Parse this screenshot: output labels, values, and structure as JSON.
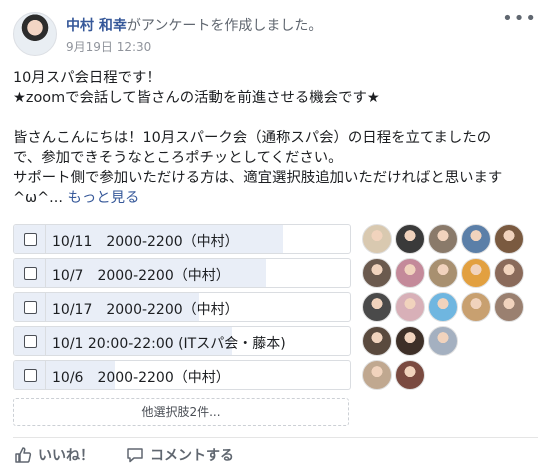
{
  "post": {
    "author": "中村 和幸",
    "action": "がアンケートを作成しました。",
    "timestamp": "9月19日 12:30",
    "more_icon": "•••"
  },
  "body": {
    "line1": "10月スパ会日程です！",
    "line2": "★zoomで会話して皆さんの活動を前進させる機会です★",
    "line3": "皆さんこんにちは！10月スパーク会（通称スパ会）の日程を立てましたの",
    "line4": "で、参加できそうなところポチッとしてください。",
    "line5": "サポート側で参加いただける方は、適宜選択肢追加いただければと思います",
    "line6": "^ω^...",
    "see_more": "もっと見る"
  },
  "poll": {
    "options": [
      {
        "label": "10/11　2000-2200（中村）",
        "fill": 0.8
      },
      {
        "label": "10/7　2000-2200（中村）",
        "fill": 0.75
      },
      {
        "label": "10/17　2000-2200（中村）",
        "fill": 0.55
      },
      {
        "label": "10/1 20:00-22:00 (ITスパ会・藤本)",
        "fill": 0.65
      },
      {
        "label": "10/6　2000-2200（中村）",
        "fill": 0.3
      }
    ],
    "more_options": "他選択肢2件..."
  },
  "voters": [
    [
      "#d9c9b0",
      "#3a3a3a",
      "#8a7a6a",
      "#5b7fa8",
      "#7a5a40"
    ],
    [
      "#6b5a4e",
      "#c48a9a",
      "#a89070",
      "#e2a040",
      "#8a6a5a"
    ],
    [
      "#4a4a4a",
      "#d8b0b8",
      "#6fb6e0",
      "#c8a070",
      "#9a8070"
    ],
    [
      "#5a4a3e",
      "#3e3028",
      "#a4b0c0"
    ],
    [
      "#c0a890",
      "#7a4a40"
    ]
  ],
  "footer": {
    "like": "いいね！",
    "comment": "コメントする"
  }
}
